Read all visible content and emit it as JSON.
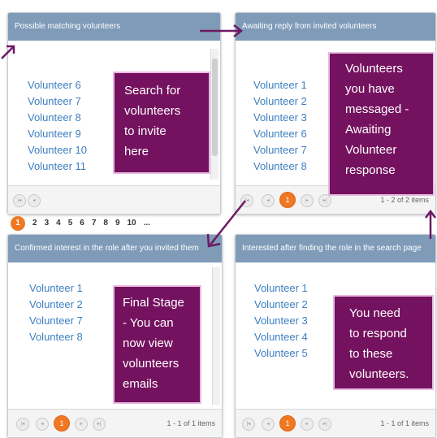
{
  "panels": {
    "possible": {
      "title": "Possible matching volunteers",
      "volunteers": [
        "Volunteer 6",
        "Volunteer 7",
        "Volunteer 8",
        "Volunteer 9",
        "Volunteer 10",
        "Volunteer 11"
      ],
      "callout": [
        "Search for",
        "volunteers",
        "to invite",
        "here"
      ],
      "pages": [
        "1",
        "2",
        "3",
        "4",
        "5",
        "6",
        "7",
        "8",
        "9",
        "10",
        "..."
      ]
    },
    "awaiting": {
      "title": "Awaiting reply from invited volunteers",
      "volunteers": [
        "Volunteer 1",
        "Volunteer 2",
        "Volunteer 3",
        "Volunteer 6",
        "Volunteer 7",
        "Volunteer 8"
      ],
      "callout": [
        "Volunteers",
        "you have",
        "messaged -",
        "Awaiting",
        "Volunteer",
        "response"
      ],
      "page": "1",
      "info": "1 - 2 of 2 items"
    },
    "confirmed": {
      "title": "Confirmed interest in the role after you invited them",
      "volunteers": [
        "Volunteer 1",
        "Volunteer 2",
        "Volunteer 7",
        "Volunteer 8"
      ],
      "callout": [
        "Final Stage",
        "- You can",
        "now view",
        "volunteers",
        "emails"
      ],
      "page": "1",
      "info": "1 - 1 of 1 items"
    },
    "interested": {
      "title": "Interested after finding the role in the search page",
      "volunteers": [
        "Volunteer 1",
        "Volunteer 2",
        "Volunteer 3",
        "Volunteer 4",
        "Volunteer 5"
      ],
      "callout": [
        "You need",
        "to respond",
        "to these",
        "volunteers."
      ],
      "page": "1",
      "info": "1 - 1 of 1 items"
    }
  },
  "colors": {
    "header": "#7f9bb8",
    "link": "#3d7fc1",
    "callout": "#74125f",
    "arrow": "#6d1a63",
    "active_page": "#f07822"
  },
  "icons": {
    "first": "first-page-icon",
    "prev": "previous-page-icon",
    "next": "next-page-icon",
    "last": "last-page-icon"
  }
}
